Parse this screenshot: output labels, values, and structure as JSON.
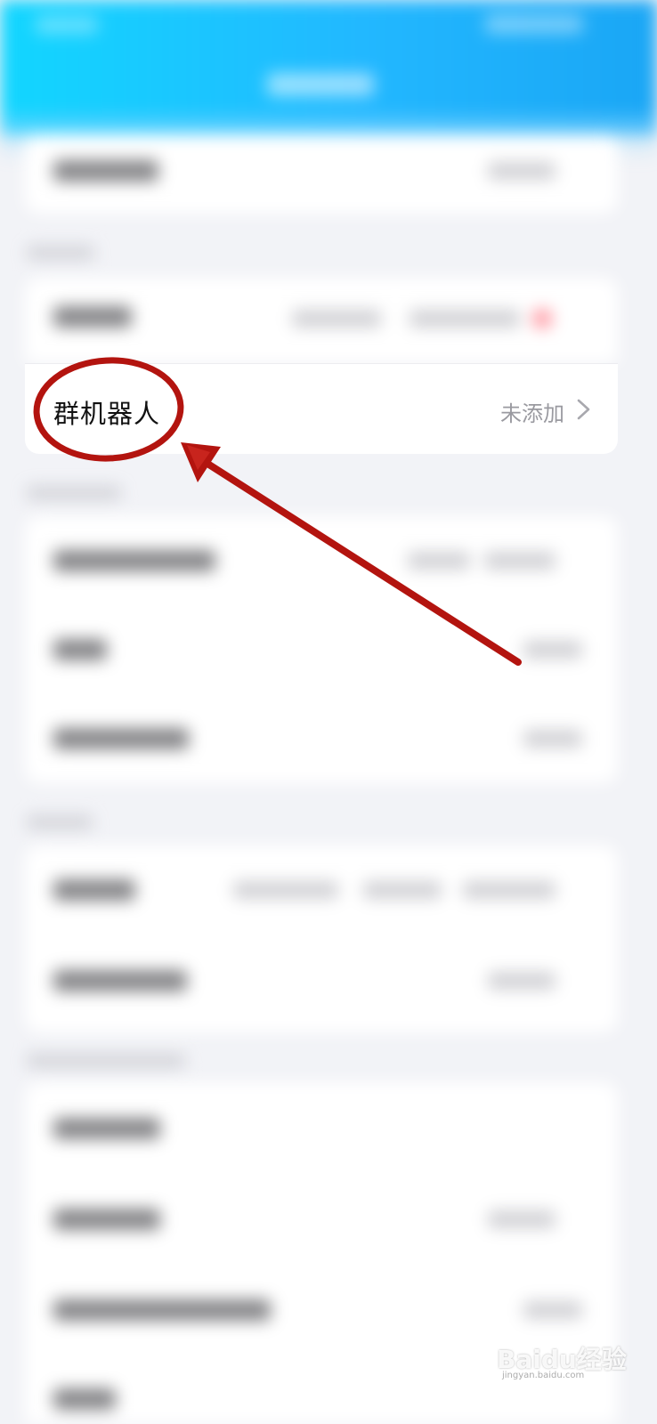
{
  "group_robot_row": {
    "label": "群机器人",
    "status": "未添加"
  },
  "icons": {
    "chevron": "chevron-right-icon"
  },
  "annotation": {
    "color": "#b3140f"
  },
  "watermark": {
    "brand": "Baidu经验",
    "url": "jingyan.baidu.com"
  }
}
